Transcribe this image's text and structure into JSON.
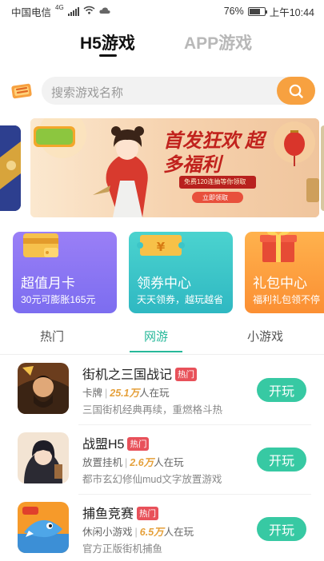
{
  "status_bar": {
    "carrier": "中国电信",
    "signal_label": "4G",
    "battery": "76%",
    "time": "上午10:44"
  },
  "top_tabs": [
    {
      "label": "H5游戏",
      "active": true
    },
    {
      "label": "APP游戏",
      "active": false
    }
  ],
  "search": {
    "placeholder": "搜索游戏名称"
  },
  "banner": {
    "headline": "首发狂欢 超多福利",
    "caption": "免费120连抽等你领取",
    "cta": "立即领取"
  },
  "cards": [
    {
      "title": "超值月卡",
      "subtitle": "30元可膨胀165元",
      "color": "#8a75f4"
    },
    {
      "title": "领券中心",
      "subtitle": "天天领券，越玩越省",
      "color": "#3cc5c8"
    },
    {
      "title": "礼包中心",
      "subtitle": "福利礼包领不停",
      "color": "#fd9c3c"
    }
  ],
  "sub_tabs": [
    {
      "label": "热门",
      "active": false
    },
    {
      "label": "网游",
      "active": true
    },
    {
      "label": "小游戏",
      "active": false
    }
  ],
  "games": [
    {
      "name": "街机之三国战记",
      "badge": "热门",
      "category": "卡牌",
      "players": "25.1万",
      "players_suffix": "人在玩",
      "desc": "三国街机经典再续，重燃格斗热",
      "play_label": "开玩"
    },
    {
      "name": "战盟H5",
      "badge": "热门",
      "category": "放置挂机",
      "players": "2.6万",
      "players_suffix": "人在玩",
      "desc": "都市玄幻修仙mud文字放置游戏",
      "play_label": "开玩"
    },
    {
      "name": "捕鱼竞赛",
      "badge": "热门",
      "category": "休闲小游戏",
      "players": "6.5万",
      "players_suffix": "人在玩",
      "desc": "官方正版街机捕鱼",
      "play_label": "开玩"
    }
  ],
  "colors": {
    "accent": "#27b89a",
    "play_button": "#37c9a3",
    "search_button": "#f7a140",
    "hot_badge": "#e8515a",
    "players_highlight": "#e5a03a"
  }
}
